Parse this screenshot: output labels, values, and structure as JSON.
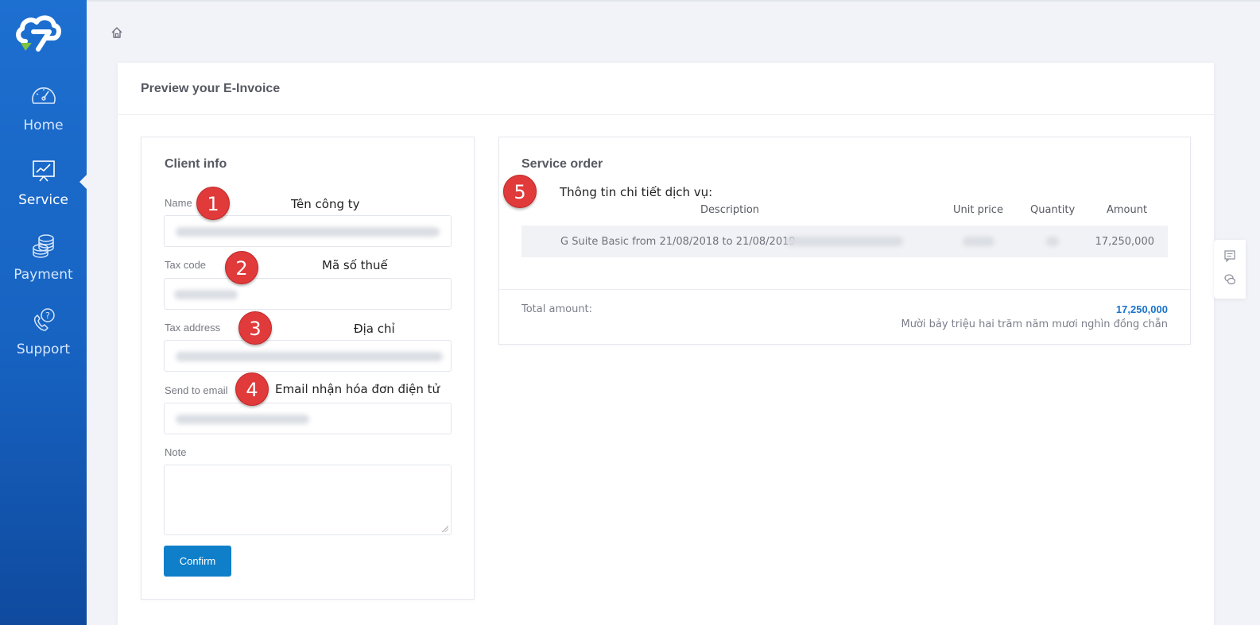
{
  "sidebar": {
    "logo_icon": "cloud-logo-icon",
    "items": [
      {
        "label": "Home",
        "icon": "speedometer-icon",
        "active": false
      },
      {
        "label": "Service",
        "icon": "chart-board-icon",
        "active": true
      },
      {
        "label": "Payment",
        "icon": "coins-icon",
        "active": false
      },
      {
        "label": "Support",
        "icon": "phone-support-icon",
        "active": false
      }
    ]
  },
  "breadcrumb": {
    "icon": "home-icon"
  },
  "page": {
    "title": "Preview your E-Invoice"
  },
  "client_info": {
    "title": "Client info",
    "fields": {
      "name": {
        "label": "Name"
      },
      "tax_code": {
        "label": "Tax code"
      },
      "tax_address": {
        "label": "Tax address"
      },
      "send_to_email": {
        "label": "Send to email"
      },
      "note": {
        "label": "Note"
      }
    },
    "confirm_label": "Confirm"
  },
  "service_order": {
    "title": "Service order",
    "columns": [
      "Description",
      "Unit price",
      "Quantity",
      "Amount"
    ],
    "rows": [
      {
        "description": "G Suite Basic from 21/08/2018 to 21/08/2019 -",
        "amount": "17,250,000"
      }
    ],
    "total_label": "Total amount:",
    "total_value": "17,250,000",
    "total_in_words": "Mười bảy triệu hai trăm năm mươi nghìn đồng chẵn"
  },
  "annotations": [
    {
      "number": "1",
      "text": "Tên công ty"
    },
    {
      "number": "2",
      "text": "Mã số thuế"
    },
    {
      "number": "3",
      "text": "Địa chỉ"
    },
    {
      "number": "4",
      "text": "Email nhận hóa đơn điện tử"
    },
    {
      "number": "5",
      "text": "Thông tin chi tiết dịch vụ:"
    }
  ],
  "colors": {
    "sidebar": "#1763c2",
    "primary_button": "#0f7fc9",
    "badge": "#e03a3a",
    "total_value": "#1a73c9"
  },
  "floating_widget": {
    "icons": [
      "message-icon",
      "chat-bubbles-icon"
    ]
  }
}
